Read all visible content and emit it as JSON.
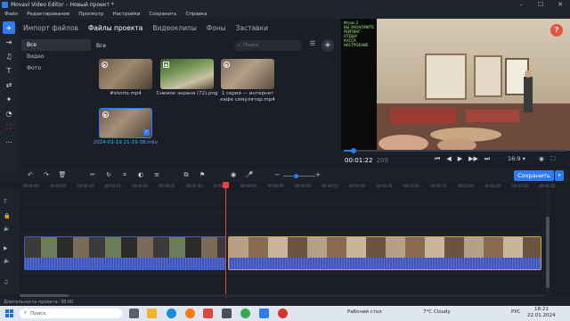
{
  "window": {
    "title": "Movavi Video Editor – Новый проект *",
    "minimize": "–",
    "maximize": "☐",
    "close": "✕"
  },
  "menu": [
    "Файл",
    "Редактирование",
    "Просмотр",
    "Настройки",
    "Сохранить",
    "Справка"
  ],
  "left_tools": [
    "add-icon",
    "import-icon",
    "music-icon",
    "text-icon",
    "transition-icon",
    "filter-icon",
    "sticker-icon",
    "effects-icon",
    "more-icon"
  ],
  "tabs": [
    {
      "label": "Импорт файлов",
      "active": false
    },
    {
      "label": "Файлы проекта",
      "active": true
    },
    {
      "label": "Видеоклипы",
      "active": false
    },
    {
      "label": "Фоны",
      "active": false
    },
    {
      "label": "Заставки",
      "active": false
    }
  ],
  "categories": [
    {
      "label": "Все",
      "selected": true
    },
    {
      "label": "Видео",
      "selected": false
    },
    {
      "label": "Фото",
      "selected": false
    }
  ],
  "media": {
    "header": "Все",
    "search_placeholder": "Поиск",
    "items": [
      {
        "caption": "#shorts.mp4",
        "selected": false
      },
      {
        "caption": "Снимок экрана (72).png",
        "selected": false
      },
      {
        "caption": "1 серия — интернет кафе симулятор.mp4",
        "selected": false
      },
      {
        "caption": "2024-01-19 21-19-38.mkv",
        "selected": true
      }
    ]
  },
  "preview": {
    "hud_lines": [
      "Игрок 2",
      "ВЫ ЭКОНОМИТЕ",
      "РЕЙТИНГ",
      "ОТДЫХ",
      "КАССА",
      "НАСТРОЕНИЕ"
    ],
    "current_time": "00:01:22",
    "total_time": "200",
    "progress": 0.04,
    "aspect_ratio": "16:9",
    "colors": {
      "accent": "#2d7cf6",
      "help": "#e0563d"
    }
  },
  "transport": [
    "⏮",
    "◀",
    "▶",
    "▶▶",
    "⏭"
  ],
  "toolbar": {
    "save_label": "Сохранить",
    "zoom_level": 0.4
  },
  "timeline": {
    "ruler": [
      "00:00:00",
      "00:00:05",
      "00:00:10",
      "00:00:15",
      "00:00:20",
      "00:00:25",
      "00:00:30",
      "00:00:35",
      "00:00:40",
      "00:00:45",
      "00:00:50",
      "00:00:55",
      "00:01:00",
      "00:01:05",
      "00:01:10",
      "00:01:15",
      "00:01:20",
      "00:01:25",
      "00:01:30",
      "00:01:35"
    ],
    "playhead_time": "00:01:22"
  },
  "status": {
    "duration_label": "Длительность проекта: 38:00"
  },
  "taskbar": {
    "search_placeholder": "Поиск",
    "desktop_label": "Рабочий стол",
    "weather": "7°C Cloudy",
    "language": "РУС",
    "time": "18:21",
    "date": "22.01.2024"
  }
}
